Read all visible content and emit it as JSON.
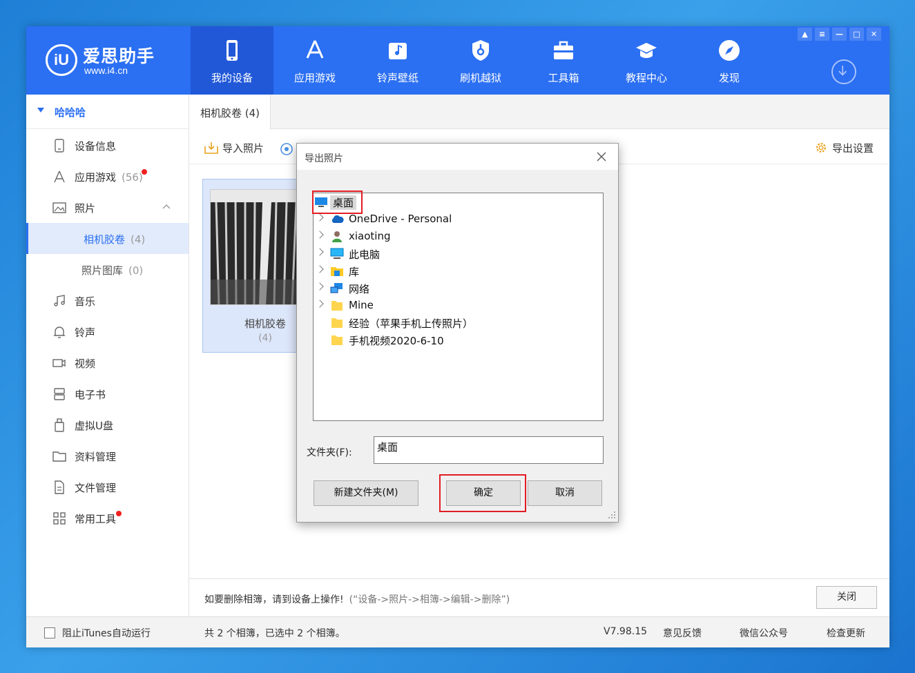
{
  "app": {
    "logo_mark": "iU",
    "logo_name": "爱思助手",
    "logo_url": "www.i4.cn"
  },
  "nav": [
    {
      "label": "我的设备",
      "icon": "phone-icon"
    },
    {
      "label": "应用游戏",
      "icon": "app-store-icon"
    },
    {
      "label": "铃声壁纸",
      "icon": "music-note-icon"
    },
    {
      "label": "刷机越狱",
      "icon": "shield-key-icon"
    },
    {
      "label": "工具箱",
      "icon": "toolbox-icon"
    },
    {
      "label": "教程中心",
      "icon": "graduation-cap-icon"
    },
    {
      "label": "发现",
      "icon": "compass-icon"
    }
  ],
  "window_controls": [
    "shirt-icon",
    "list-icon",
    "minimize-icon",
    "maximize-icon",
    "close-icon"
  ],
  "sidebar": {
    "device_name": "哈哈哈",
    "items": [
      {
        "label": "设备信息",
        "count": "",
        "icon": "device-info-icon"
      },
      {
        "label": "应用游戏",
        "count": "(56)",
        "icon": "app-store-icon"
      },
      {
        "label": "照片",
        "count": "",
        "icon": "photo-icon"
      },
      {
        "label": "相机胶卷",
        "count": "(4)",
        "icon": ""
      },
      {
        "label": "照片图库",
        "count": "(0)",
        "icon": ""
      },
      {
        "label": "音乐",
        "count": "",
        "icon": "music-icon"
      },
      {
        "label": "铃声",
        "count": "",
        "icon": "bell-icon"
      },
      {
        "label": "视频",
        "count": "",
        "icon": "video-icon"
      },
      {
        "label": "电子书",
        "count": "",
        "icon": "ebook-icon"
      },
      {
        "label": "虚拟U盘",
        "count": "",
        "icon": "usb-drive-icon"
      },
      {
        "label": "资料管理",
        "count": "",
        "icon": "folder-icon"
      },
      {
        "label": "文件管理",
        "count": "",
        "icon": "file-icon"
      },
      {
        "label": "常用工具",
        "count": "",
        "icon": "grid-icon"
      }
    ]
  },
  "main": {
    "tab_label": "相机胶卷 (4)",
    "toolbar": {
      "import_label": "导入照片",
      "export_settings_label": "导出设置"
    },
    "album": {
      "name": "相机胶卷",
      "count": "(4)"
    },
    "delete_msg": "如要删除相簿，请到设备上操作!",
    "delete_hint": "(“设备->照片->相簿->编辑->删除”)",
    "close_label": "关闭"
  },
  "status": {
    "itunes_label": "阻止iTunes自动运行",
    "summary": "共 2 个相簿，已选中 2 个相簿。",
    "version": "V7.98.15",
    "feedback": "意见反馈",
    "wechat": "微信公众号",
    "update": "检查更新"
  },
  "dialog": {
    "title": "导出照片",
    "tree": [
      {
        "label": "桌面",
        "icon": "desktop-icon",
        "expandable": false,
        "selected": true
      },
      {
        "label": "OneDrive - Personal",
        "icon": "cloud-icon",
        "expandable": true
      },
      {
        "label": "xiaoting",
        "icon": "user-icon",
        "expandable": true
      },
      {
        "label": "此电脑",
        "icon": "computer-icon",
        "expandable": true
      },
      {
        "label": "库",
        "icon": "library-icon",
        "expandable": true
      },
      {
        "label": "网络",
        "icon": "network-icon",
        "expandable": true
      },
      {
        "label": "Mine",
        "icon": "folder-icon",
        "expandable": true
      },
      {
        "label": "经验（苹果手机上传照片）",
        "icon": "folder-icon",
        "expandable": false
      },
      {
        "label": "手机视频2020-6-10",
        "icon": "folder-icon",
        "expandable": false
      }
    ],
    "folder_label": "文件夹(F):",
    "folder_value": "桌面",
    "new_folder_label": "新建文件夹(M)",
    "ok_label": "确定",
    "cancel_label": "取消"
  },
  "colors": {
    "brand": "#2b6ff2",
    "highlight": "#e21c24",
    "badge": "#f02020"
  }
}
